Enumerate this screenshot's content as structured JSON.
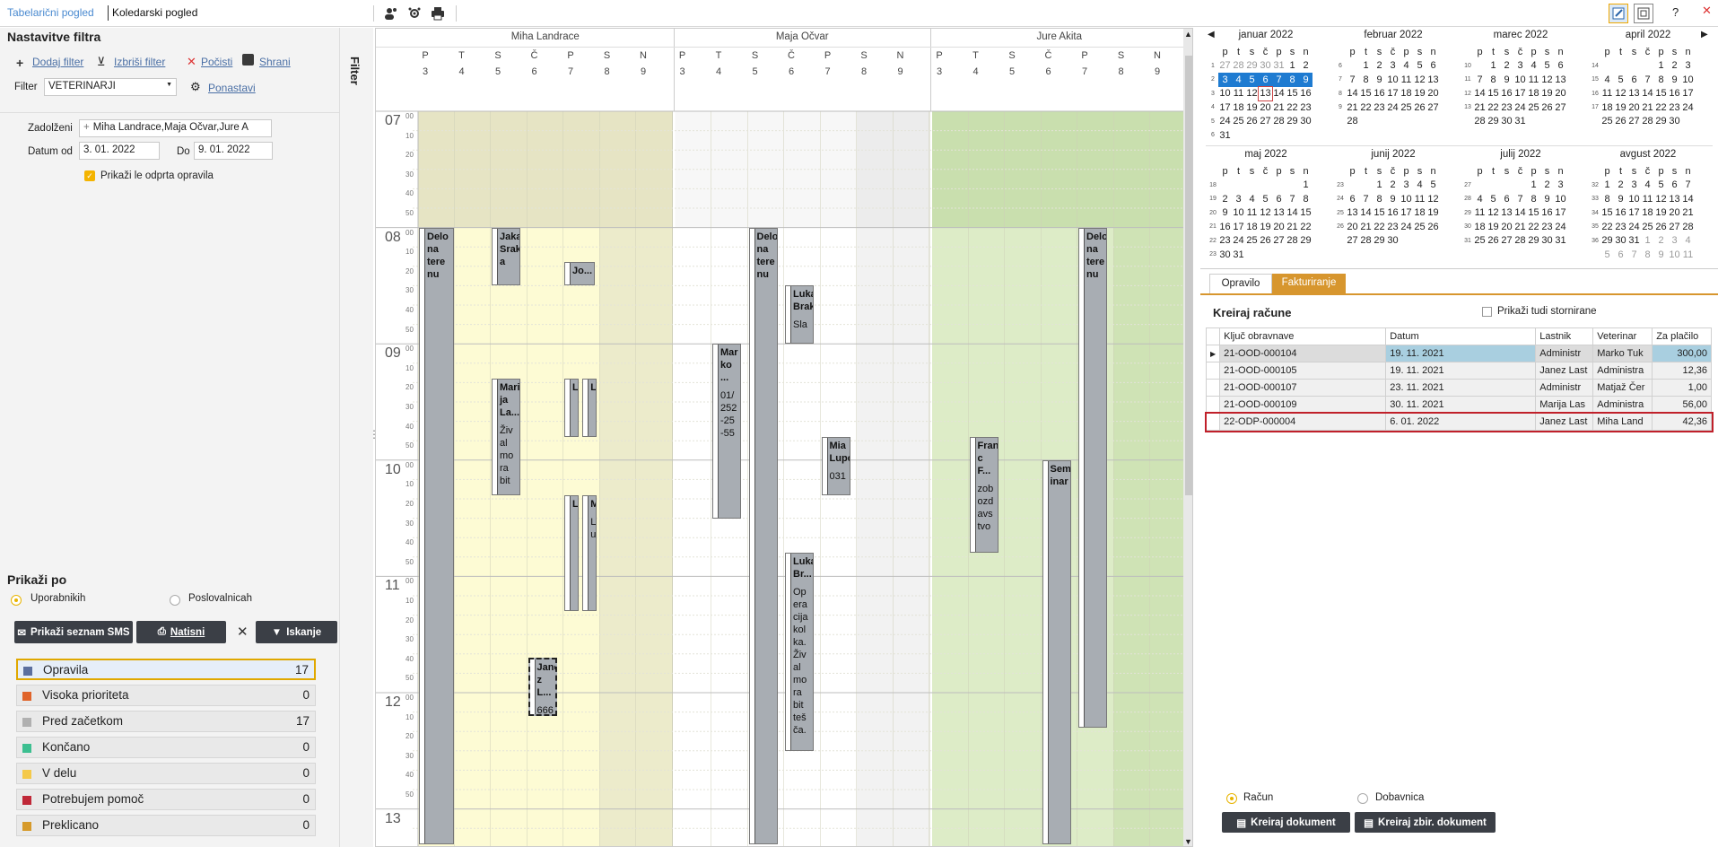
{
  "tabs": {
    "table": "Tabelarični pogled",
    "calendar": "Koledarski pogled"
  },
  "top_right": {
    "help": "?",
    "close": "✕"
  },
  "filter": {
    "title": "Nastavitve filtra",
    "add": "Dodaj filter",
    "delete": "Izbriši filter",
    "clear": "Počisti",
    "save": "Shrani",
    "filter_label": "Filter",
    "filter_value": "VETERINARJI",
    "reset": "Ponastavi",
    "assigned_label": "Zadolženi",
    "assigned_value": "Miha Landrace,Maja Očvar,Jure A",
    "date_from_label": "Datum od",
    "date_from": "3. 01. 2022",
    "date_to_label": "Do",
    "date_to": "9. 01. 2022",
    "only_open": "Prikaži le odprta opravila",
    "side_tab": "Filter"
  },
  "show_by": {
    "title": "Prikaži po",
    "opt1": "Uporabnikih",
    "opt2": "Poslovalnicah"
  },
  "buttons": {
    "sms": "Prikaži seznam SMS",
    "print": "Natisni",
    "search": "Iskanje",
    "clear_x": "✕"
  },
  "statuses": [
    {
      "name": "Opravila",
      "count": "17",
      "color": "#5b6f9e"
    },
    {
      "name": "Visoka prioriteta",
      "count": "0",
      "color": "#e0642a"
    },
    {
      "name": "Pred začetkom",
      "count": "17",
      "color": "#b0b0b0"
    },
    {
      "name": "Končano",
      "count": "0",
      "color": "#3cbf90"
    },
    {
      "name": "V delu",
      "count": "0",
      "color": "#f4c94a"
    },
    {
      "name": "Potrebujem pomoč",
      "count": "0",
      "color": "#c02838"
    },
    {
      "name": "Preklicano",
      "count": "0",
      "color": "#d69a2a"
    }
  ],
  "calendar": {
    "persons": [
      "Miha Landrace",
      "Maja Očvar",
      "Jure Akita"
    ],
    "days": [
      "P",
      "T",
      "S",
      "Č",
      "P",
      "S",
      "N"
    ],
    "dates": [
      "3",
      "4",
      "5",
      "6",
      "7",
      "8",
      "9"
    ],
    "hours": [
      "07",
      "08",
      "09",
      "10",
      "11",
      "12",
      "13"
    ],
    "minutes": [
      "00",
      "10",
      "20",
      "30",
      "40",
      "50"
    ],
    "events": [
      {
        "title": "Delo na tere nu",
        "body": ""
      },
      {
        "title": "Jaka Srak a",
        "body": ""
      },
      {
        "title": "Jo...",
        "body": ""
      },
      {
        "title": "Mari ja La...",
        "body": "Živ al mo ra bit"
      },
      {
        "title": "L",
        "body": ""
      },
      {
        "title": "L",
        "body": ""
      },
      {
        "title": "L",
        "body": ""
      },
      {
        "title": "M",
        "body": "L upo"
      },
      {
        "title": "Jane z L...",
        "body": "666"
      },
      {
        "title": "Mar ko ...",
        "body": "01/ 252 -25 -55"
      },
      {
        "title": "Delo na tere nu",
        "body": ""
      },
      {
        "title": "Luka Brak",
        "body": "Sla"
      },
      {
        "title": "Mia Lupo",
        "body": "031"
      },
      {
        "title": "Luka Br...",
        "body": "Op era cija kol ka. Živ al mo ra bit teš ča."
      },
      {
        "title": "Fran c F...",
        "body": "zob ozd avs tvo"
      },
      {
        "title": "Sem inar",
        "body": ""
      },
      {
        "title": "Delo na tere nu",
        "body": ""
      }
    ]
  },
  "mini_calendars": [
    {
      "title": "januar 2022",
      "weeks": [
        "1",
        "2",
        "3",
        "4",
        "5",
        "6"
      ],
      "rows": [
        [
          "27",
          "28",
          "29",
          "30",
          "31",
          "1",
          "2"
        ],
        [
          "3",
          "4",
          "5",
          "6",
          "7",
          "8",
          "9"
        ],
        [
          "10",
          "11",
          "12",
          "13",
          "14",
          "15",
          "16"
        ],
        [
          "17",
          "18",
          "19",
          "20",
          "21",
          "22",
          "23"
        ],
        [
          "24",
          "25",
          "26",
          "27",
          "28",
          "29",
          "30"
        ],
        [
          "31",
          "",
          "",
          "",
          "",
          "",
          ""
        ]
      ]
    },
    {
      "title": "februar 2022",
      "weeks": [
        "6",
        "7",
        "8",
        "9"
      ],
      "rows": [
        [
          "",
          "1",
          "2",
          "3",
          "4",
          "5",
          "6"
        ],
        [
          "7",
          "8",
          "9",
          "10",
          "11",
          "12",
          "13"
        ],
        [
          "14",
          "15",
          "16",
          "17",
          "18",
          "19",
          "20"
        ],
        [
          "21",
          "22",
          "23",
          "24",
          "25",
          "26",
          "27"
        ],
        [
          "28",
          "",
          "",
          "",
          "",
          "",
          ""
        ]
      ]
    },
    {
      "title": "marec 2022",
      "weeks": [
        "10",
        "11",
        "12",
        "13"
      ],
      "rows": [
        [
          "",
          "1",
          "2",
          "3",
          "4",
          "5",
          "6"
        ],
        [
          "7",
          "8",
          "9",
          "10",
          "11",
          "12",
          "13"
        ],
        [
          "14",
          "15",
          "16",
          "17",
          "18",
          "19",
          "20"
        ],
        [
          "21",
          "22",
          "23",
          "24",
          "25",
          "26",
          "27"
        ],
        [
          "28",
          "29",
          "30",
          "31",
          "",
          "",
          ""
        ]
      ]
    },
    {
      "title": "april 2022",
      "weeks": [
        "14",
        "15",
        "16",
        "17"
      ],
      "rows": [
        [
          "",
          "",
          "",
          "",
          "1",
          "2",
          "3"
        ],
        [
          "4",
          "5",
          "6",
          "7",
          "8",
          "9",
          "10"
        ],
        [
          "11",
          "12",
          "13",
          "14",
          "15",
          "16",
          "17"
        ],
        [
          "18",
          "19",
          "20",
          "21",
          "22",
          "23",
          "24"
        ],
        [
          "25",
          "26",
          "27",
          "28",
          "29",
          "30",
          ""
        ]
      ]
    },
    {
      "title": "maj 2022",
      "weeks": [
        "18",
        "19",
        "20",
        "21",
        "22",
        "23"
      ],
      "rows": [
        [
          "",
          "",
          "",
          "",
          "",
          "",
          "1"
        ],
        [
          "2",
          "3",
          "4",
          "5",
          "6",
          "7",
          "8"
        ],
        [
          "9",
          "10",
          "11",
          "12",
          "13",
          "14",
          "15"
        ],
        [
          "16",
          "17",
          "18",
          "19",
          "20",
          "21",
          "22"
        ],
        [
          "23",
          "24",
          "25",
          "26",
          "27",
          "28",
          "29"
        ],
        [
          "30",
          "31",
          "",
          "",
          "",
          "",
          ""
        ]
      ]
    },
    {
      "title": "junij 2022",
      "weeks": [
        "23",
        "24",
        "25",
        "26"
      ],
      "rows": [
        [
          "",
          "",
          "1",
          "2",
          "3",
          "4",
          "5"
        ],
        [
          "6",
          "7",
          "8",
          "9",
          "10",
          "11",
          "12"
        ],
        [
          "13",
          "14",
          "15",
          "16",
          "17",
          "18",
          "19"
        ],
        [
          "20",
          "21",
          "22",
          "23",
          "24",
          "25",
          "26"
        ],
        [
          "27",
          "28",
          "29",
          "30",
          "",
          "",
          ""
        ]
      ]
    },
    {
      "title": "julij 2022",
      "weeks": [
        "27",
        "28",
        "29",
        "30",
        "31"
      ],
      "rows": [
        [
          "",
          "",
          "",
          "",
          "1",
          "2",
          "3"
        ],
        [
          "4",
          "5",
          "6",
          "7",
          "8",
          "9",
          "10"
        ],
        [
          "11",
          "12",
          "13",
          "14",
          "15",
          "16",
          "17"
        ],
        [
          "18",
          "19",
          "20",
          "21",
          "22",
          "23",
          "24"
        ],
        [
          "25",
          "26",
          "27",
          "28",
          "29",
          "30",
          "31"
        ]
      ]
    },
    {
      "title": "avgust 2022",
      "weeks": [
        "32",
        "33",
        "34",
        "35",
        "36"
      ],
      "rows": [
        [
          "1",
          "2",
          "3",
          "4",
          "5",
          "6",
          "7"
        ],
        [
          "8",
          "9",
          "10",
          "11",
          "12",
          "13",
          "14"
        ],
        [
          "15",
          "16",
          "17",
          "18",
          "19",
          "20",
          "21"
        ],
        [
          "22",
          "23",
          "24",
          "25",
          "26",
          "27",
          "28"
        ],
        [
          "29",
          "30",
          "31",
          "1",
          "2",
          "3",
          "4"
        ],
        [
          "5",
          "6",
          "7",
          "8",
          "9",
          "10",
          "11"
        ]
      ]
    }
  ],
  "weekday_heads": [
    "p",
    "t",
    "s",
    "č",
    "p",
    "s",
    "n"
  ],
  "invoice": {
    "tab1": "Opravilo",
    "tab2": "Fakturiranje",
    "title": "Kreiraj račune",
    "show_cancelled": "Prikaži tudi stornirane",
    "columns": [
      "Ključ obravnave",
      "Datum",
      "Lastnik",
      "Veterinar",
      "Za plačilo"
    ],
    "rows": [
      [
        "21-OOD-000104",
        "19. 11. 2021",
        "Administr",
        "Marko Tuk",
        "300,00"
      ],
      [
        "21-OOD-000105",
        "19. 11. 2021",
        "Janez Last",
        "Administra",
        "12,36"
      ],
      [
        "21-OOD-000107",
        "23. 11. 2021",
        "Administr",
        "Matjaž Čer",
        "1,00"
      ],
      [
        "21-OOD-000109",
        "30. 11. 2021",
        "Marija Las",
        "Administra",
        "56,00"
      ],
      [
        "22-ODP-000004",
        "6. 01. 2022",
        "Janez Last",
        "Miha Land",
        "42,36"
      ]
    ],
    "radio1": "Račun",
    "radio2": "Dobavnica",
    "btn1": "Kreiraj dokument",
    "btn2": "Kreiraj zbir. dokument"
  }
}
